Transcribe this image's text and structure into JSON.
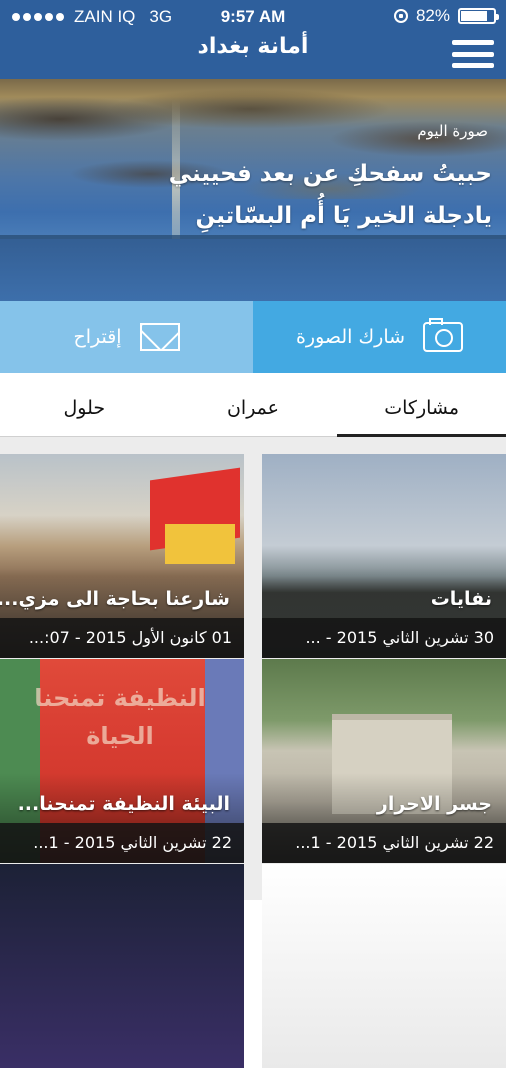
{
  "status_bar": {
    "carrier": "ZAIN IQ",
    "network": "3G",
    "time": "9:57 AM",
    "battery_percent": "82%",
    "battery_level": 0.82
  },
  "header": {
    "title": "أمانة بغداد",
    "menu_icon": "hamburger-menu-icon"
  },
  "hero": {
    "tag": "صورة اليوم",
    "line1": "حبيتُ سفحكِ عن بعد فحييني",
    "line2": "يادجلة الخير يَا أُم البسّاتينِ"
  },
  "actions": {
    "share_label": "شارك الصورة",
    "share_icon": "camera-icon",
    "suggest_label": "إقتراح",
    "suggest_icon": "envelope-icon"
  },
  "tabs": [
    {
      "label": "مشاركات",
      "active": true
    },
    {
      "label": "عمران",
      "active": false
    },
    {
      "label": "حلول",
      "active": false
    }
  ],
  "posts": [
    {
      "title": "نفايات",
      "date": "30 تشرين الثاني 2015 - ..."
    },
    {
      "title": "شارعنا بحاجة الى مزي...",
      "date": "01 كانون الأول 2015 - 07:..."
    },
    {
      "title": "جسر الاحرار",
      "date": "22 تشرين الثاني 2015 - 1..."
    },
    {
      "title": "البيئة النظيفة تمنحنا...",
      "date": "22 تشرين الثاني 2015 - 1..."
    }
  ],
  "banner_text": "النظيفة تمنحنا الحياة"
}
